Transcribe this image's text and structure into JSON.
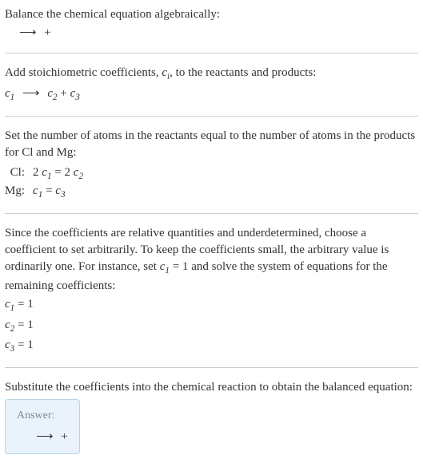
{
  "section1": {
    "title": "Balance the chemical equation algebraically:",
    "equation_lhs": "",
    "equation_arrow": "⟶",
    "equation_rhs": " + "
  },
  "section2": {
    "intro_a": "Add stoichiometric coefficients, ",
    "ci": "c",
    "ci_sub": "i",
    "intro_b": ", to the reactants and products:",
    "c1": "c",
    "c1_sub": "1",
    "gap1": " ",
    "arrow": "⟶",
    "c2": "c",
    "c2_sub": "2",
    "plus": " + ",
    "c3": "c",
    "c3_sub": "3"
  },
  "section3": {
    "intro": "Set the number of atoms in the reactants equal to the number of atoms in the products for Cl and Mg:",
    "row1_label": "Cl:",
    "row1_lhs_coef": "2 ",
    "row1_c1": "c",
    "row1_c1_sub": "1",
    "row1_eq": " = ",
    "row1_rhs_coef": "2 ",
    "row1_c2": "c",
    "row1_c2_sub": "2",
    "row2_label": "Mg:",
    "row2_c1": "c",
    "row2_c1_sub": "1",
    "row2_eq": " = ",
    "row2_c3": "c",
    "row2_c3_sub": "3"
  },
  "section4": {
    "intro_a": "Since the coefficients are relative quantities and underdetermined, choose a coefficient to set arbitrarily. To keep the coefficients small, the arbitrary value is ordinarily one. For instance, set ",
    "c1": "c",
    "c1_sub": "1",
    "intro_b": " = 1 and solve the system of equations for the remaining coefficients:",
    "eq1_c": "c",
    "eq1_sub": "1",
    "eq1_rest": " = 1",
    "eq2_c": "c",
    "eq2_sub": "2",
    "eq2_rest": " = 1",
    "eq3_c": "c",
    "eq3_sub": "3",
    "eq3_rest": " = 1"
  },
  "section5": {
    "intro": "Substitute the coefficients into the chemical reaction to obtain the balanced equation:",
    "answer_label": "Answer:",
    "equation_lhs": "",
    "equation_arrow": "⟶",
    "equation_rhs": " + "
  }
}
